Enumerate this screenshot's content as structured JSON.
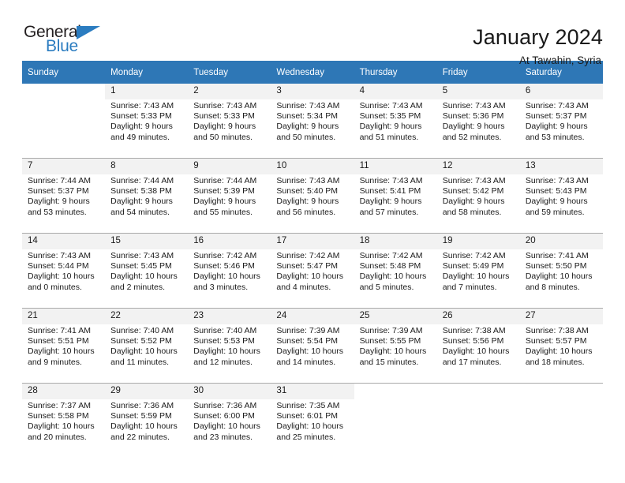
{
  "brand": {
    "name_top": "General",
    "name_bottom": "Blue",
    "triangle_color": "#2b7cc0"
  },
  "header": {
    "title": "January 2024",
    "subtitle": "At Tawahin, Syria"
  },
  "colors": {
    "header_blue": "#2e77b6",
    "daynum_band": "#f2f2f2",
    "text": "#1a1a1a",
    "row_divider": "#a9a9a9"
  },
  "weekdays": [
    "Sunday",
    "Monday",
    "Tuesday",
    "Wednesday",
    "Thursday",
    "Friday",
    "Saturday"
  ],
  "labels": {
    "sunrise_prefix": "Sunrise:",
    "sunset_prefix": "Sunset:",
    "daylight_prefix": "Daylight:"
  },
  "weeks": [
    [
      {
        "day": "",
        "empty": true
      },
      {
        "day": "1",
        "sunrise": "Sunrise: 7:43 AM",
        "sunset": "Sunset: 5:33 PM",
        "daylight1": "Daylight: 9 hours",
        "daylight2": "and 49 minutes."
      },
      {
        "day": "2",
        "sunrise": "Sunrise: 7:43 AM",
        "sunset": "Sunset: 5:33 PM",
        "daylight1": "Daylight: 9 hours",
        "daylight2": "and 50 minutes."
      },
      {
        "day": "3",
        "sunrise": "Sunrise: 7:43 AM",
        "sunset": "Sunset: 5:34 PM",
        "daylight1": "Daylight: 9 hours",
        "daylight2": "and 50 minutes."
      },
      {
        "day": "4",
        "sunrise": "Sunrise: 7:43 AM",
        "sunset": "Sunset: 5:35 PM",
        "daylight1": "Daylight: 9 hours",
        "daylight2": "and 51 minutes."
      },
      {
        "day": "5",
        "sunrise": "Sunrise: 7:43 AM",
        "sunset": "Sunset: 5:36 PM",
        "daylight1": "Daylight: 9 hours",
        "daylight2": "and 52 minutes."
      },
      {
        "day": "6",
        "sunrise": "Sunrise: 7:43 AM",
        "sunset": "Sunset: 5:37 PM",
        "daylight1": "Daylight: 9 hours",
        "daylight2": "and 53 minutes."
      }
    ],
    [
      {
        "day": "7",
        "sunrise": "Sunrise: 7:44 AM",
        "sunset": "Sunset: 5:37 PM",
        "daylight1": "Daylight: 9 hours",
        "daylight2": "and 53 minutes."
      },
      {
        "day": "8",
        "sunrise": "Sunrise: 7:44 AM",
        "sunset": "Sunset: 5:38 PM",
        "daylight1": "Daylight: 9 hours",
        "daylight2": "and 54 minutes."
      },
      {
        "day": "9",
        "sunrise": "Sunrise: 7:44 AM",
        "sunset": "Sunset: 5:39 PM",
        "daylight1": "Daylight: 9 hours",
        "daylight2": "and 55 minutes."
      },
      {
        "day": "10",
        "sunrise": "Sunrise: 7:43 AM",
        "sunset": "Sunset: 5:40 PM",
        "daylight1": "Daylight: 9 hours",
        "daylight2": "and 56 minutes."
      },
      {
        "day": "11",
        "sunrise": "Sunrise: 7:43 AM",
        "sunset": "Sunset: 5:41 PM",
        "daylight1": "Daylight: 9 hours",
        "daylight2": "and 57 minutes."
      },
      {
        "day": "12",
        "sunrise": "Sunrise: 7:43 AM",
        "sunset": "Sunset: 5:42 PM",
        "daylight1": "Daylight: 9 hours",
        "daylight2": "and 58 minutes."
      },
      {
        "day": "13",
        "sunrise": "Sunrise: 7:43 AM",
        "sunset": "Sunset: 5:43 PM",
        "daylight1": "Daylight: 9 hours",
        "daylight2": "and 59 minutes."
      }
    ],
    [
      {
        "day": "14",
        "sunrise": "Sunrise: 7:43 AM",
        "sunset": "Sunset: 5:44 PM",
        "daylight1": "Daylight: 10 hours",
        "daylight2": "and 0 minutes."
      },
      {
        "day": "15",
        "sunrise": "Sunrise: 7:43 AM",
        "sunset": "Sunset: 5:45 PM",
        "daylight1": "Daylight: 10 hours",
        "daylight2": "and 2 minutes."
      },
      {
        "day": "16",
        "sunrise": "Sunrise: 7:42 AM",
        "sunset": "Sunset: 5:46 PM",
        "daylight1": "Daylight: 10 hours",
        "daylight2": "and 3 minutes."
      },
      {
        "day": "17",
        "sunrise": "Sunrise: 7:42 AM",
        "sunset": "Sunset: 5:47 PM",
        "daylight1": "Daylight: 10 hours",
        "daylight2": "and 4 minutes."
      },
      {
        "day": "18",
        "sunrise": "Sunrise: 7:42 AM",
        "sunset": "Sunset: 5:48 PM",
        "daylight1": "Daylight: 10 hours",
        "daylight2": "and 5 minutes."
      },
      {
        "day": "19",
        "sunrise": "Sunrise: 7:42 AM",
        "sunset": "Sunset: 5:49 PM",
        "daylight1": "Daylight: 10 hours",
        "daylight2": "and 7 minutes."
      },
      {
        "day": "20",
        "sunrise": "Sunrise: 7:41 AM",
        "sunset": "Sunset: 5:50 PM",
        "daylight1": "Daylight: 10 hours",
        "daylight2": "and 8 minutes."
      }
    ],
    [
      {
        "day": "21",
        "sunrise": "Sunrise: 7:41 AM",
        "sunset": "Sunset: 5:51 PM",
        "daylight1": "Daylight: 10 hours",
        "daylight2": "and 9 minutes."
      },
      {
        "day": "22",
        "sunrise": "Sunrise: 7:40 AM",
        "sunset": "Sunset: 5:52 PM",
        "daylight1": "Daylight: 10 hours",
        "daylight2": "and 11 minutes."
      },
      {
        "day": "23",
        "sunrise": "Sunrise: 7:40 AM",
        "sunset": "Sunset: 5:53 PM",
        "daylight1": "Daylight: 10 hours",
        "daylight2": "and 12 minutes."
      },
      {
        "day": "24",
        "sunrise": "Sunrise: 7:39 AM",
        "sunset": "Sunset: 5:54 PM",
        "daylight1": "Daylight: 10 hours",
        "daylight2": "and 14 minutes."
      },
      {
        "day": "25",
        "sunrise": "Sunrise: 7:39 AM",
        "sunset": "Sunset: 5:55 PM",
        "daylight1": "Daylight: 10 hours",
        "daylight2": "and 15 minutes."
      },
      {
        "day": "26",
        "sunrise": "Sunrise: 7:38 AM",
        "sunset": "Sunset: 5:56 PM",
        "daylight1": "Daylight: 10 hours",
        "daylight2": "and 17 minutes."
      },
      {
        "day": "27",
        "sunrise": "Sunrise: 7:38 AM",
        "sunset": "Sunset: 5:57 PM",
        "daylight1": "Daylight: 10 hours",
        "daylight2": "and 18 minutes."
      }
    ],
    [
      {
        "day": "28",
        "sunrise": "Sunrise: 7:37 AM",
        "sunset": "Sunset: 5:58 PM",
        "daylight1": "Daylight: 10 hours",
        "daylight2": "and 20 minutes."
      },
      {
        "day": "29",
        "sunrise": "Sunrise: 7:36 AM",
        "sunset": "Sunset: 5:59 PM",
        "daylight1": "Daylight: 10 hours",
        "daylight2": "and 22 minutes."
      },
      {
        "day": "30",
        "sunrise": "Sunrise: 7:36 AM",
        "sunset": "Sunset: 6:00 PM",
        "daylight1": "Daylight: 10 hours",
        "daylight2": "and 23 minutes."
      },
      {
        "day": "31",
        "sunrise": "Sunrise: 7:35 AM",
        "sunset": "Sunset: 6:01 PM",
        "daylight1": "Daylight: 10 hours",
        "daylight2": "and 25 minutes."
      },
      {
        "day": "",
        "empty": true
      },
      {
        "day": "",
        "empty": true
      },
      {
        "day": "",
        "empty": true
      }
    ]
  ]
}
